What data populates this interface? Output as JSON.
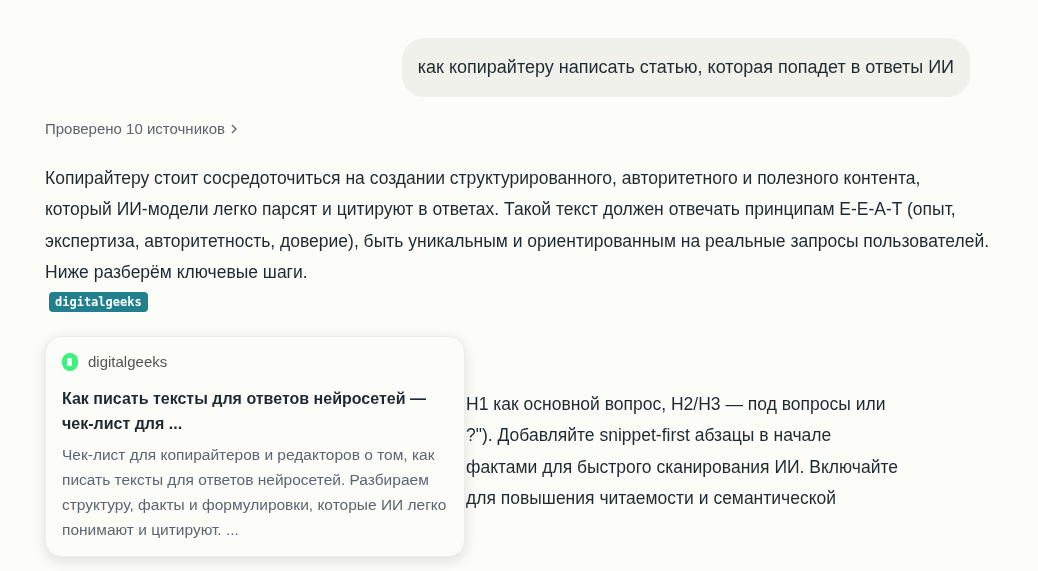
{
  "user_message": "как копирайтеру написать статью, которая попадет в ответы ИИ",
  "sources_link": "Проверено 10 источников",
  "paragraph": "Копирайтеру стоит сосредоточиться на создании структурированного, авторитетного и полезного контента, который ИИ-модели легко парсят и цитируют в ответах. Такой текст должен отвечать принципам E-E-A-T (опыт, экспертиза, авторитетность, доверие), быть уникальным и ориентированным на реальные запросы пользователей. Ниже разберём ключевые шаги.",
  "citation_chip": "digitalgeeks",
  "partial_lines": [
    "Н1 как основной вопрос, Н2/Н3 — под вопросы или",
    "?\"). Добавляйте snippet-first абзацы в начале",
    "фактами для быстрого сканирования ИИ. Включайте",
    "для повышения читаемости и семантической"
  ],
  "popover": {
    "site": "digitalgeeks",
    "title": "Как писать тексты для ответов нейросетей — чек-лист для ...",
    "snippet": "Чек-лист для копирайтеров и редакторов о том, как писать тексты для ответов нейросетей. Разбираем структуру, факты и формулировки, которые ИИ легко понимают и цитируют. ..."
  }
}
